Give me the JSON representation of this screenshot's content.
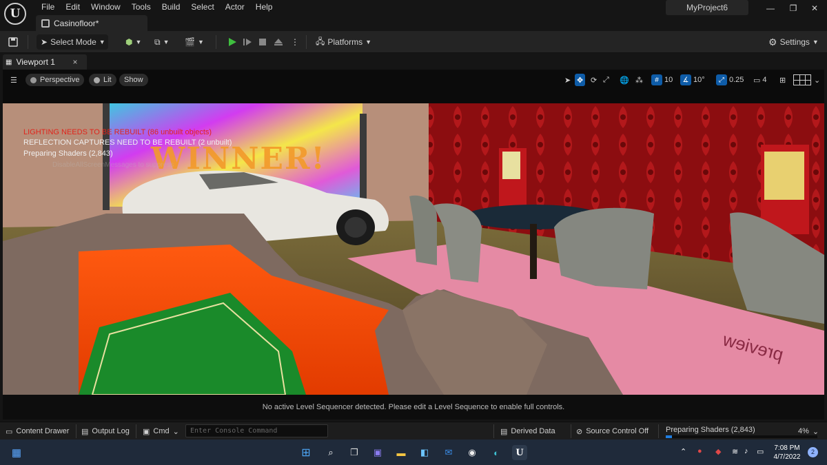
{
  "app": {
    "logo": "U",
    "project_name": "MyProject6"
  },
  "menu": [
    "File",
    "Edit",
    "Window",
    "Tools",
    "Build",
    "Select",
    "Actor",
    "Help"
  ],
  "document_tab": {
    "label": "Casinofloor*"
  },
  "window_controls": {
    "minimize": "—",
    "maximize": "❐",
    "close": "✕"
  },
  "toolbar": {
    "select_mode": "Select Mode",
    "platforms": "Platforms",
    "settings": "Settings"
  },
  "viewport_tab": {
    "label": "Viewport 1",
    "close": "×"
  },
  "viewport_toolbar": {
    "perspective": "Perspective",
    "lit": "Lit",
    "show": "Show",
    "grid_snap": "10",
    "rotation_snap": "10°",
    "scale_snap": "0.25",
    "camera_speed": "4"
  },
  "viewport_overlay": {
    "lighting_warning": "LIGHTING NEEDS TO BE REBUILT (86 unbuilt objects)",
    "reflection_warning": "REFLECTION CAPTURES NEED TO BE REBUILT (2 unbuilt)",
    "preparing_shaders": "Preparing Shaders (2,843)",
    "disable_hint": "DisableAllScreenMessages to suppress",
    "preview_watermark": "preview",
    "sign_text": "WINNER!"
  },
  "sequencer_message": "No active Level Sequencer detected. Please edit a Level Sequence to enable full controls.",
  "bottom_bar": {
    "content_drawer": "Content Drawer",
    "output_log": "Output Log",
    "cmd": "Cmd",
    "console_placeholder": "Enter Console Command",
    "derived_data": "Derived Data",
    "source_control": "Source Control Off",
    "progress_label": "Preparing Shaders (2,843)",
    "progress_percent": "4%",
    "progress_value": 0.04
  },
  "taskbar": {
    "time": "7:08 PM",
    "date": "4/7/2022",
    "notifications": "2"
  },
  "colors": {
    "accent": "#0e5ca8",
    "play_green": "#3fbf3f",
    "warning_red": "#e0241b"
  }
}
